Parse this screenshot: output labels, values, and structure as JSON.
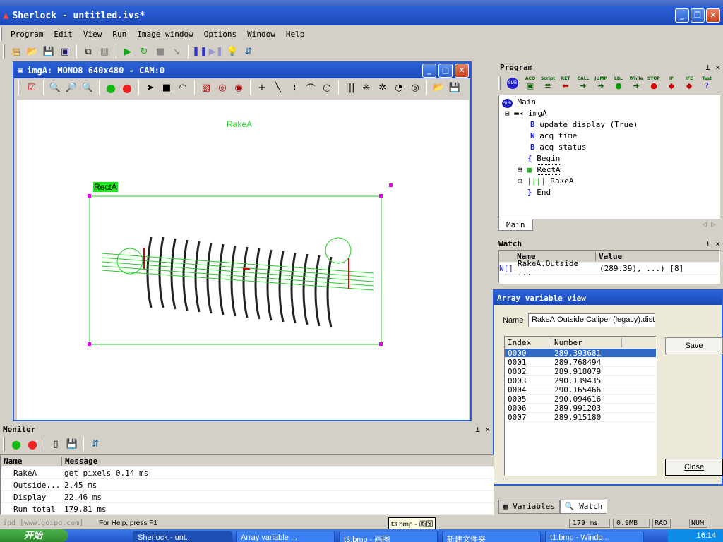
{
  "app": {
    "title": "Sherlock - untitled.ivs*",
    "behind_title": "Sherlock - untitled.ivs*"
  },
  "menu": [
    "Program",
    "Edit",
    "View",
    "Run",
    "Image window",
    "Options",
    "Window",
    "Help"
  ],
  "image_window": {
    "title": "imgA: MONO8 640x480 - CAM:0",
    "rake_label": "RakeA",
    "rect_label": "RectA"
  },
  "program": {
    "title": "Program",
    "palette": [
      "SUB",
      "ACQ",
      "Script",
      "RET",
      "CALL",
      "JUMP",
      "LBL",
      "While",
      "STOP",
      "IF",
      "IFE",
      "Test"
    ],
    "tree": {
      "main": "Main",
      "img": "imgA",
      "update": "update display (True)",
      "acq_time": "acq time",
      "acq_status": "acq status",
      "begin": "Begin",
      "rect": "RectA",
      "rake": "RakeA",
      "end": "End"
    },
    "tab": "Main"
  },
  "watch": {
    "title": "Watch",
    "col_name": "Name",
    "col_value": "Value",
    "row_icon": "N[]",
    "row_name": "RakeA.Outside ...",
    "row_value": "(289.39), ...) [8]"
  },
  "array_view": {
    "title": "Array variable view",
    "name_label": "Name",
    "name_value": "RakeA.Outside Caliper (legacy).dist",
    "col_index": "Index",
    "col_number": "Number",
    "rows": [
      {
        "i": "0000",
        "v": "289.393681"
      },
      {
        "i": "0001",
        "v": "289.768494"
      },
      {
        "i": "0002",
        "v": "289.918079"
      },
      {
        "i": "0003",
        "v": "290.139435"
      },
      {
        "i": "0004",
        "v": "290.165466"
      },
      {
        "i": "0005",
        "v": "290.094616"
      },
      {
        "i": "0006",
        "v": "289.991203"
      },
      {
        "i": "0007",
        "v": "289.915180"
      }
    ],
    "save": "Save",
    "close": "Close"
  },
  "bottom_tabs": {
    "variables": "Variables",
    "watch": "Watch"
  },
  "monitor": {
    "title": "Monitor",
    "col_name": "Name",
    "col_message": "Message",
    "rows": [
      {
        "n": "RakeA",
        "m": "get pixels 0.14 ms"
      },
      {
        "n": "Outside...",
        "m": "2.45 ms"
      },
      {
        "n": "Display",
        "m": "22.46 ms"
      },
      {
        "n": "Run total",
        "m": "179.81 ms"
      }
    ]
  },
  "status": {
    "left": "ipd [www.goipd.com]",
    "help": "For Help, press F1",
    "tooltip": "t3.bmp - 画图",
    "time": "179 ms",
    "mem": "0.9MB",
    "rad": "RAD",
    "num": "NUM"
  },
  "taskbar": {
    "start": "开始",
    "items": [
      "Sherlock - unt...",
      "Array variable ...",
      "t3.bmp - 画图",
      "新建文件夹",
      "t1.bmp - Windo..."
    ],
    "clock": "16:14"
  }
}
